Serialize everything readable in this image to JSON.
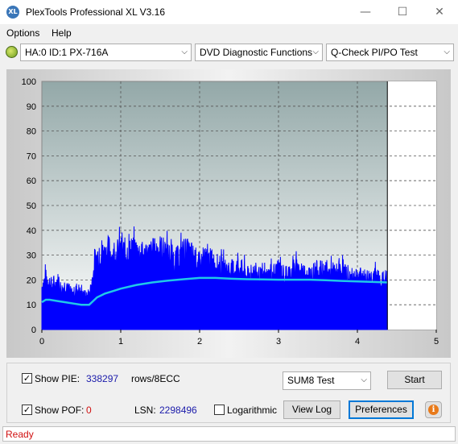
{
  "window": {
    "title": "PlexTools Professional XL V3.16",
    "icon_text": "XL",
    "minimize": "—",
    "maximize": "☐",
    "close": "✕"
  },
  "menu": [
    {
      "label": "Options"
    },
    {
      "label": "Help"
    }
  ],
  "toolbar": {
    "drive": "HA:0 ID:1  PX-716A",
    "function": "DVD Diagnostic Functions",
    "test": "Q-Check PI/PO Test",
    "arrow": "⌵"
  },
  "chart_data": {
    "type": "area",
    "ylim": [
      0,
      100
    ],
    "xlim": [
      0,
      5
    ],
    "yticks": [
      "0",
      "10",
      "20",
      "30",
      "40",
      "50",
      "60",
      "70",
      "80",
      "90",
      "100"
    ],
    "xticks": [
      "0",
      "1",
      "2",
      "3",
      "4",
      "5"
    ],
    "grid": true,
    "end_marker_x": 4.38,
    "colors": {
      "pie": "#0000ff",
      "sum8": "#20c8e8",
      "plot_top": "#93a8a8",
      "plot_bottom": "#ffffff"
    },
    "series": [
      {
        "x": [
          0,
          0.05,
          0.1,
          0.15,
          0.2,
          0.25,
          0.3,
          0.35,
          0.4,
          0.45,
          0.5,
          0.55,
          0.6,
          0.65,
          0.7,
          0.75,
          0.8,
          0.85,
          0.9,
          0.95,
          1.0,
          1.1,
          1.2,
          1.3,
          1.4,
          1.5,
          1.6,
          1.7,
          1.8,
          1.9,
          2.0,
          2.1,
          2.2,
          2.3,
          2.4,
          2.5,
          2.6,
          2.7,
          2.8,
          2.9,
          3.0,
          3.1,
          3.2,
          3.3,
          3.4,
          3.5,
          3.6,
          3.7,
          3.8,
          3.9,
          4.0,
          4.1,
          4.2,
          4.3,
          4.38
        ],
        "values": [
          22,
          26,
          24,
          21,
          25,
          20,
          23,
          19,
          18,
          21,
          18,
          17,
          17,
          28,
          37,
          40,
          38,
          41,
          36,
          39,
          40,
          39,
          40,
          37,
          39,
          41,
          38,
          35,
          40,
          38,
          33,
          36,
          33,
          31,
          30,
          32,
          27,
          29,
          26,
          28,
          30,
          27,
          31,
          29,
          28,
          30,
          29,
          28,
          30,
          26,
          27,
          26,
          27,
          25,
          26
        ]
      },
      {
        "x": [
          0,
          0.05,
          0.1,
          0.2,
          0.3,
          0.4,
          0.5,
          0.55,
          0.6,
          0.65,
          0.7,
          0.8,
          0.9,
          1.0,
          1.2,
          1.4,
          1.6,
          1.8,
          2.0,
          2.2,
          2.4,
          2.6,
          2.8,
          3.0,
          3.2,
          3.4,
          3.6,
          3.8,
          4.0,
          4.2,
          4.38
        ],
        "values": [
          11,
          12,
          12,
          11.5,
          11,
          10.5,
          10,
          10,
          10,
          11.5,
          13,
          14.5,
          15.5,
          16.5,
          18,
          19,
          19.7,
          20.3,
          20.8,
          20.8,
          20.5,
          20.3,
          20.2,
          20.1,
          20.1,
          20.1,
          19.9,
          19.6,
          19.4,
          19.2,
          19
        ]
      }
    ]
  },
  "bottom": {
    "show_pie_label": "Show PIE:",
    "pie_value": "338297",
    "rows_label": "rows/8ECC",
    "show_pof_label": "Show POF:",
    "pof_value": "0",
    "lsn_label": "LSN:",
    "lsn_value": "2298496",
    "log_label": "Logarithmic",
    "test_select": "SUM8 Test",
    "start": "Start",
    "view_log": "View Log",
    "preferences": "Preferences",
    "check": "✓",
    "info": "i"
  },
  "status": "Ready"
}
